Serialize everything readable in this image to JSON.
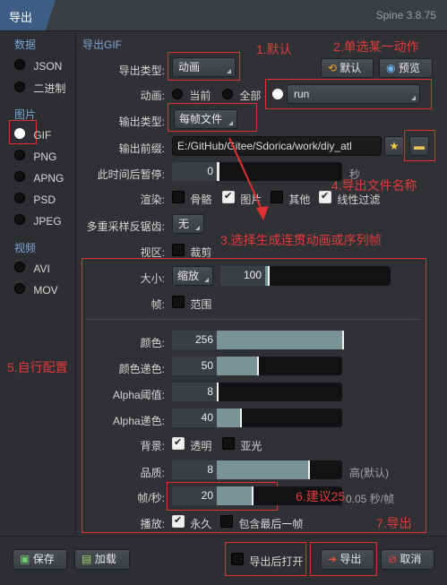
{
  "window": {
    "title": "导出",
    "version": "Spine 3.8.75"
  },
  "sidebar": {
    "data_section": "数据",
    "data_items": [
      "JSON",
      "二进制"
    ],
    "image_section": "图片",
    "image_items": [
      "GIF",
      "PNG",
      "APNG",
      "PSD",
      "JPEG"
    ],
    "video_section": "视频",
    "video_items": [
      "AVI",
      "MOV"
    ],
    "selected": "GIF"
  },
  "main": {
    "section_title": "导出GIF",
    "export_type_label": "导出类型:",
    "export_type_value": "动画",
    "animation_label": "动画:",
    "animation_current": "当前",
    "animation_all": "全部",
    "animation_value": "run",
    "output_type_label": "输出类型:",
    "output_type_value": "每帧文件",
    "output_prefix_label": "输出前缀:",
    "output_prefix_value": "E:/GitHub/Gitee/Sdorica/work/diy_atl",
    "pause_label": "此时间后暂停:",
    "pause_value": "0",
    "pause_unit": "秒",
    "render_label": "渲染:",
    "render_bones": "骨骼",
    "render_images": "图片",
    "render_other": "其他",
    "render_linear": "线性过滤",
    "msaa_label": "多重采样反锯齿:",
    "msaa_value": "无",
    "viewport_label": "视区:",
    "viewport_crop": "裁剪",
    "size_label": "大小:",
    "size_mode": "缩放",
    "size_value": "100",
    "size_fraction": 0.28,
    "frames_label": "帧:",
    "frames_range": "范围",
    "colors_label": "颜色:",
    "colors_value": "256",
    "colors_fraction": 1.0,
    "color_dither_label": "颜色递色:",
    "color_dither_value": "50",
    "color_dither_fraction": 0.5,
    "alpha_threshold_label": "Alpha阈值:",
    "alpha_threshold_value": "8",
    "alpha_threshold_fraction": 0.03,
    "alpha_dither_label": "Alpha递色:",
    "alpha_dither_value": "40",
    "alpha_dither_fraction": 0.4,
    "background_label": "背景:",
    "background_transparent": "透明",
    "background_matte": "亚光",
    "quality_label": "品质:",
    "quality_value": "8",
    "quality_fraction": 0.8,
    "quality_note": "高(默认)",
    "fps_label": "帧/秒:",
    "fps_value": "20",
    "fps_fraction": 0.47,
    "fps_note": "0.05 秒/帧",
    "playback_label": "播放:",
    "playback_forever": "永久",
    "playback_last_frame": "包含最后一帧"
  },
  "toolbar": {
    "default_label": "默认",
    "preview_label": "预览"
  },
  "footer": {
    "save_label": "保存",
    "load_label": "加载",
    "open_after_label": "导出后打开",
    "export_label": "导出",
    "cancel_label": "取消"
  },
  "annotations": {
    "a1": "1.默认",
    "a2": "2.单选某一动作",
    "a3": "3.选择生成连贯动画或序列帧",
    "a4": "4.导出文件名称",
    "a5": "5.自行配置",
    "a6": "6.建议25",
    "a7": "7.导出"
  },
  "colors": {
    "accent": "#3d5d84",
    "annotation": "#e03030",
    "section": "#7aa7d6"
  }
}
